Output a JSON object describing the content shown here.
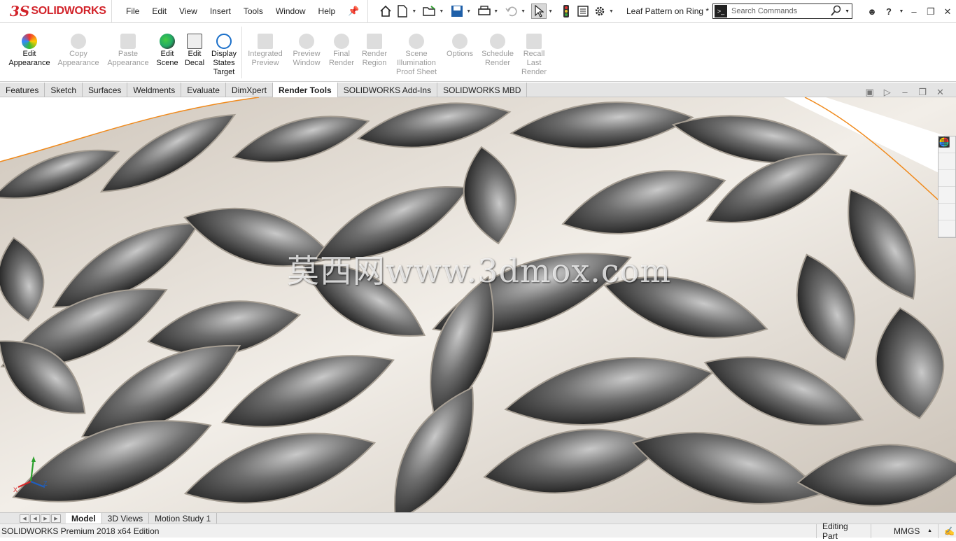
{
  "app": {
    "brand_ds": "3S",
    "brand_name": "SOLIDWORKS",
    "document_title": "Leaf Pattern on Ring *"
  },
  "menu": [
    "File",
    "Edit",
    "View",
    "Insert",
    "Tools",
    "Window",
    "Help"
  ],
  "search": {
    "placeholder": "Search Commands"
  },
  "ribbon": {
    "enabled": [
      {
        "label": "Edit\nAppearance",
        "icon": "edit-appearance-icon"
      },
      {
        "label": "Edit\nScene",
        "icon": "edit-scene-icon"
      },
      {
        "label": "Edit\nDecal",
        "icon": "edit-decal-icon"
      },
      {
        "label": "Display\nStates\nTarget",
        "icon": "display-states-icon"
      }
    ],
    "disabled": [
      {
        "label": "Copy\nAppearance"
      },
      {
        "label": "Paste\nAppearance"
      },
      {
        "label": "Integrated\nPreview"
      },
      {
        "label": "Preview\nWindow"
      },
      {
        "label": "Final\nRender"
      },
      {
        "label": "Render\nRegion"
      },
      {
        "label": "Scene\nIllumination\nProof Sheet"
      },
      {
        "label": "Options"
      },
      {
        "label": "Schedule\nRender"
      },
      {
        "label": "Recall\nLast\nRender"
      }
    ]
  },
  "tabs": [
    "Features",
    "Sketch",
    "Surfaces",
    "Weldments",
    "Evaluate",
    "DimXpert",
    "Render Tools",
    "SOLIDWORKS Add-Ins",
    "SOLIDWORKS MBD"
  ],
  "active_tab": "Render Tools",
  "watermark": "莫西网www.3dmox.com",
  "bottom_tabs": [
    "Model",
    "3D Views",
    "Motion Study 1"
  ],
  "status": {
    "edition": "SOLIDWORKS Premium 2018 x64 Edition",
    "mode": "Editing Part",
    "units": "MMGS"
  },
  "colors": {
    "brand_red": "#d2232a",
    "accent_blue": "#1a6fc9",
    "edge_orange": "#f08a1c"
  }
}
